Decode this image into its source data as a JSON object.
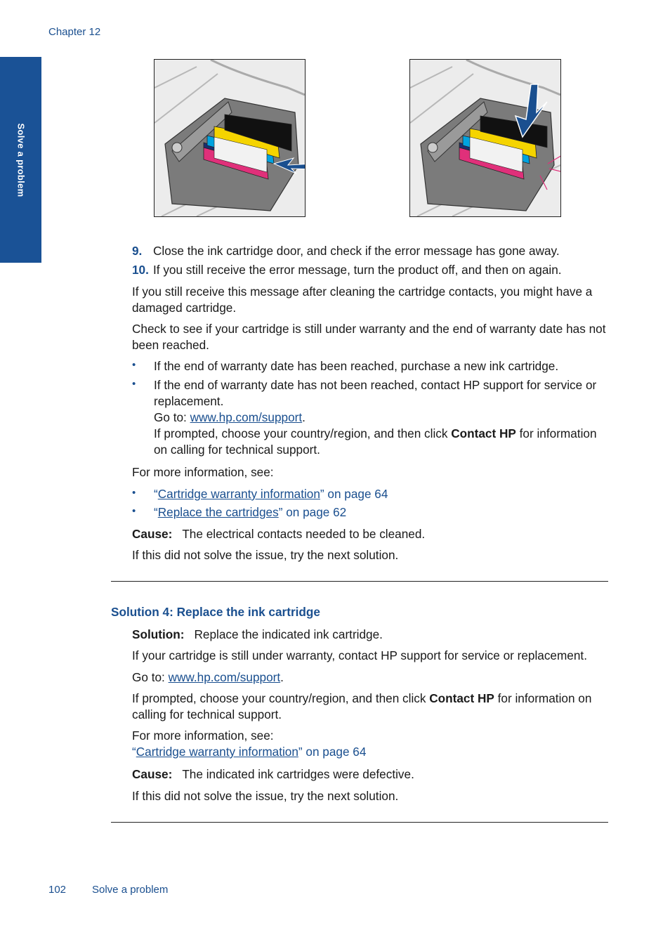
{
  "header": {
    "chapter": "Chapter 12"
  },
  "side_tab": {
    "label": "Solve a problem"
  },
  "figures": [
    {
      "name": "cartridge-latch-lift-illustration",
      "arrow": "curved-arrow",
      "colors": [
        "#1a1a1a",
        "#f5d400",
        "#00a3e0",
        "#e0307a",
        "#1a4f8f"
      ]
    },
    {
      "name": "cartridge-press-down-illustration",
      "arrow": "down-arrow",
      "callout_color": "#e0307a"
    }
  ],
  "steps": [
    {
      "number": "9.",
      "text": "Close the ink cartridge door, and check if the error message has gone away."
    },
    {
      "number": "10.",
      "text": "If you still receive the error message, turn the product off, and then on again."
    }
  ],
  "para_damaged": "If you still receive this message after cleaning the cartridge contacts, you might have a damaged cartridge.",
  "para_check_warranty": "Check to see if your cartridge is still under warranty and the end of warranty date has not been reached.",
  "warranty_bullets": {
    "bullet_glyph": "•",
    "item1": "If the end of warranty date has been reached, purchase a new ink cartridge.",
    "item2": "If the end of warranty date has not been reached, contact HP support for service or replacement.",
    "goto_prefix": "Go to: ",
    "goto_link": "www.hp.com/support",
    "goto_suffix": ".",
    "prompt_prefix": "If prompted, choose your country/region, and then click ",
    "prompt_bold": "Contact HP",
    "prompt_suffix": " for information on calling for technical support."
  },
  "more_info": {
    "label": "For more information, see:",
    "links": [
      {
        "open_quote": "“",
        "link": "Cartridge warranty information",
        "close": "” on page 64"
      },
      {
        "open_quote": "“",
        "link": "Replace the cartridges",
        "close": "” on page 62"
      }
    ]
  },
  "cause3": {
    "label": "Cause:",
    "text": "The electrical contacts needed to be cleaned."
  },
  "next3": "If this did not solve the issue, try the next solution.",
  "solution4": {
    "heading": "Solution 4: Replace the ink cartridge",
    "solution_label": "Solution:",
    "solution_text": "Replace the indicated ink cartridge.",
    "warranty_text": "If your cartridge is still under warranty, contact HP support for service or replacement.",
    "goto_prefix": "Go to: ",
    "goto_link": "www.hp.com/support",
    "goto_suffix": ".",
    "prompt_prefix": "If prompted, choose your country/region, and then click ",
    "prompt_bold": "Contact HP",
    "prompt_suffix": " for information on calling for technical support.",
    "more_label": "For more information, see:",
    "more_link_open": "“",
    "more_link": "Cartridge warranty information",
    "more_link_close": "” on page 64",
    "cause_label": "Cause:",
    "cause_text": "The indicated ink cartridges were defective.",
    "next": "If this did not solve the issue, try the next solution."
  },
  "footer": {
    "page_number": "102",
    "section": "Solve a problem"
  }
}
